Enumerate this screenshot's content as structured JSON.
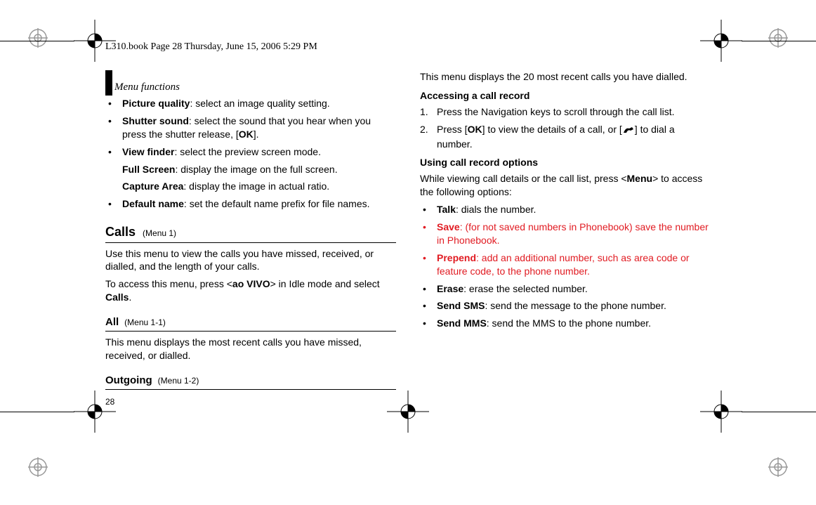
{
  "header_line": "L310.book  Page 28  Thursday, June 15, 2006  5:29 PM",
  "page_number": "28",
  "section_title": "Menu functions",
  "left": {
    "li1": {
      "b": "Picture quality",
      "rest": ": select an image quality setting."
    },
    "li2": {
      "b": "Shutter sound",
      "rest": ": select the sound that you hear when you press the shutter release, [",
      "ok": "OK",
      "rest2": "]."
    },
    "li3": {
      "b": "View finder",
      "rest": ": select the preview screen mode."
    },
    "li3a": {
      "b": "Full Screen",
      "rest": ": display the image on the full screen."
    },
    "li3b": {
      "b": "Capture Area",
      "rest": ": display the image in actual ratio."
    },
    "li4": {
      "b": "Default name",
      "rest": ": set the default name prefix for file names."
    },
    "calls_h": "Calls",
    "calls_menu": "(Menu 1)",
    "calls_p1": "Use this menu to view the calls you have missed, received, or dialled, and the length of your calls.",
    "calls_p2a": "To access this menu, press <",
    "calls_p2b": "ao VIVO",
    "calls_p2c": "> in Idle mode and select ",
    "calls_p2d": "Calls",
    "calls_p2e": ".",
    "all_h": "All",
    "all_menu": "(Menu 1-1)",
    "all_p": "This menu displays the most recent calls you have missed, received, or dialled.",
    "out_h": "Outgoing",
    "out_menu": "(Menu 1-2)"
  },
  "right": {
    "p1": "This menu displays the 20 most recent calls you have dialled.",
    "h_access": "Accessing a call record",
    "ol1": "Press the Navigation keys to scroll through the call list.",
    "ol2a": "Press [",
    "ol2ok": "OK",
    "ol2b": "] to view the details of a call, or [",
    "ol2c": "] to dial a number.",
    "h_using": "Using call record options",
    "p2a": "While viewing call details or the call list, press <",
    "p2b": "Menu",
    "p2c": "> to access the following options:",
    "li1": {
      "b": "Talk",
      "rest": ": dials the number."
    },
    "li2": {
      "b": "Save",
      "rest": ": (for not saved numbers in Phonebook) save the number in Phonebook."
    },
    "li3": {
      "b": "Prepend",
      "rest": ": add an additional number, such as area code or feature code, to the phone number."
    },
    "li4": {
      "b": "Erase",
      "rest": ": erase the selected number."
    },
    "li5": {
      "b": "Send SMS",
      "rest": ": send the message to the phone number."
    },
    "li6": {
      "b": "Send MMS",
      "rest": ": send the MMS to the phone number."
    }
  }
}
